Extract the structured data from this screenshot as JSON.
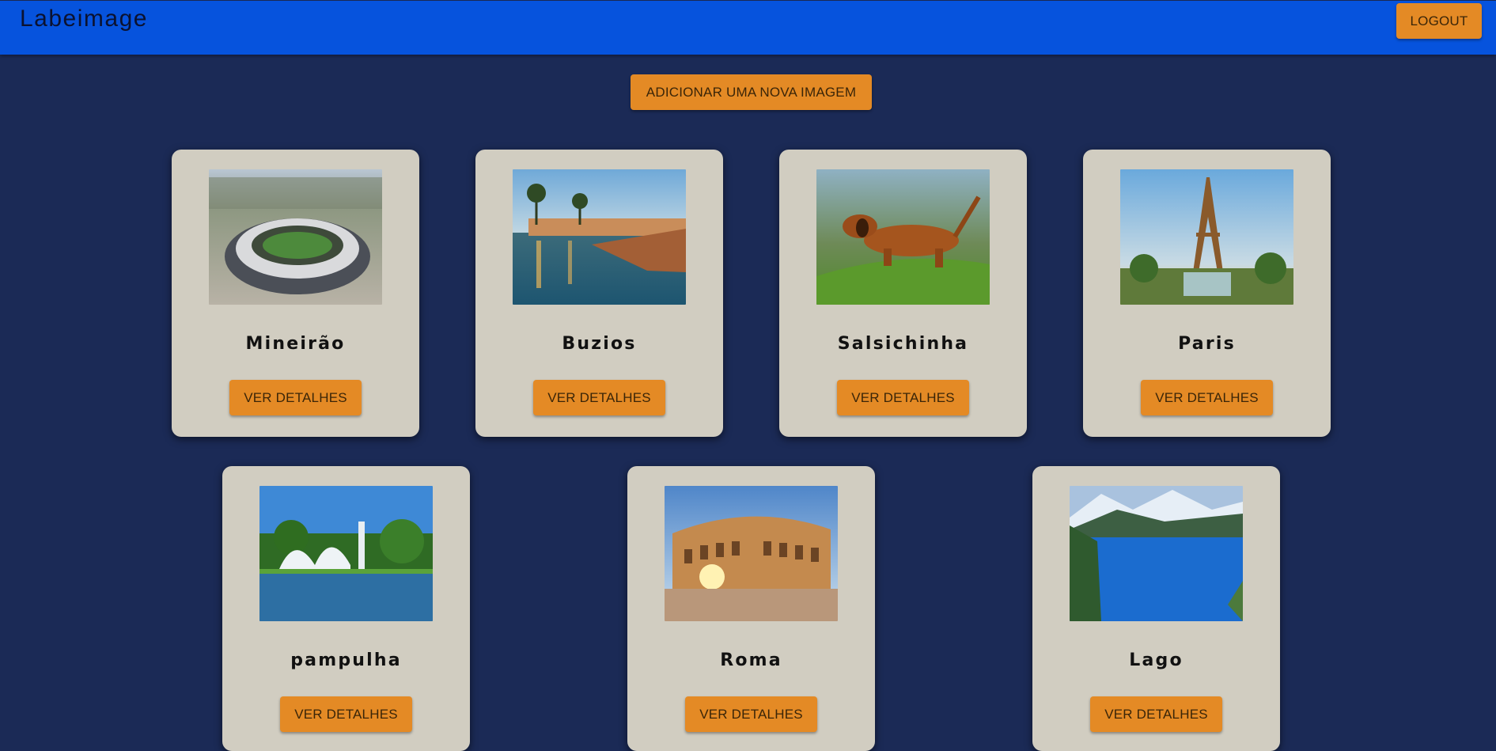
{
  "header": {
    "title": "Labeimage",
    "logout_label": "LOGOUT"
  },
  "actions": {
    "add_label": "ADICIONAR UMA NOVA IMAGEM"
  },
  "colors": {
    "background": "#1b2a56",
    "appbar": "#0653dd",
    "accent": "#e48a25",
    "card": "#d1cdc1"
  },
  "cards": [
    {
      "title": "Mineirão",
      "button": "VER DETALHES",
      "image": "stadium-aerial-photo"
    },
    {
      "title": "Buzios",
      "button": "VER DETALHES",
      "image": "waterfront-pier-photo"
    },
    {
      "title": "Salsichinha",
      "button": "VER DETALHES",
      "image": "dachshund-running-photo"
    },
    {
      "title": "Paris",
      "button": "VER DETALHES",
      "image": "eiffel-tower-photo"
    },
    {
      "title": "pampulha",
      "button": "VER DETALHES",
      "image": "pampulha-church-lake-photo"
    },
    {
      "title": "Roma",
      "button": "VER DETALHES",
      "image": "colosseum-photo"
    },
    {
      "title": "Lago",
      "button": "VER DETALHES",
      "image": "mountain-lake-photo"
    }
  ]
}
